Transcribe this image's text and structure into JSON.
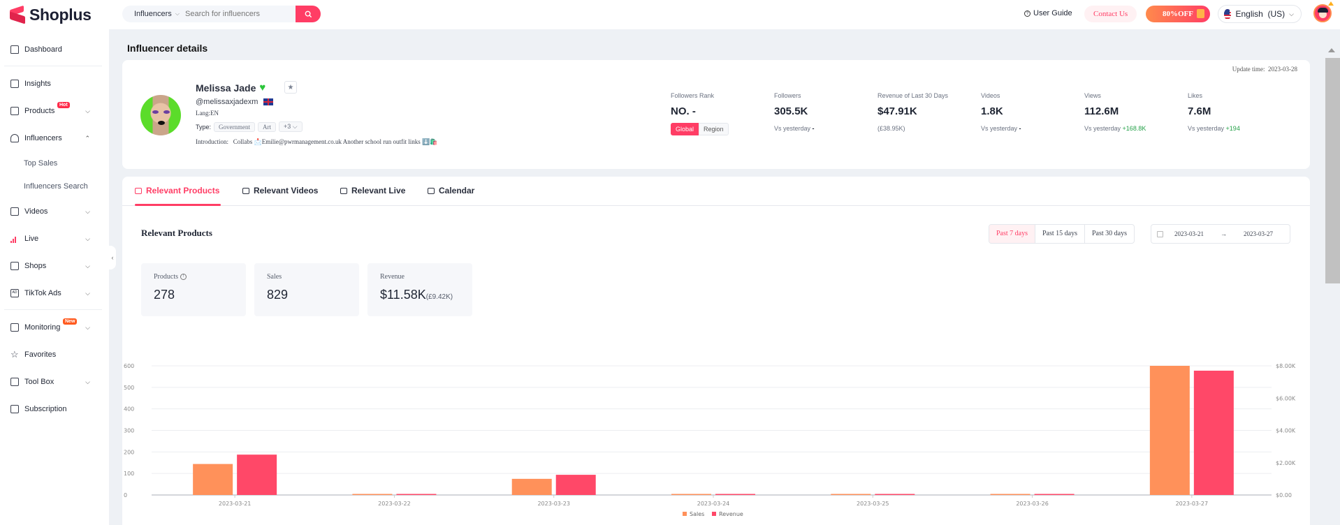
{
  "app": {
    "name": "Shoplus"
  },
  "search": {
    "category": "Influencers",
    "placeholder": "Search for influencers"
  },
  "topbar": {
    "user_guide": "User Guide",
    "contact": "Contact Us",
    "promo": "80%OFF",
    "language": "English  (US)"
  },
  "sidebar": {
    "items": [
      {
        "label": "Dashboard",
        "icon": "home-icon"
      },
      {
        "label": "Insights",
        "icon": "chart-icon"
      },
      {
        "label": "Products",
        "icon": "bag-icon",
        "badge": "Hot",
        "expandable": true
      },
      {
        "label": "Influencers",
        "icon": "user-icon",
        "expanded": true
      },
      {
        "label": "Videos",
        "icon": "video-icon",
        "expandable": true
      },
      {
        "label": "Live",
        "icon": "live-icon",
        "expandable": true
      },
      {
        "label": "Shops",
        "icon": "shop-icon",
        "expandable": true
      },
      {
        "label": "TikTok Ads",
        "icon": "ad-icon",
        "expandable": true
      },
      {
        "label": "Monitoring",
        "icon": "monitor-icon",
        "badge": "New",
        "expandable": true
      },
      {
        "label": "Favorites",
        "icon": "star-icon"
      },
      {
        "label": "Tool Box",
        "icon": "toolbox-icon",
        "expandable": true
      },
      {
        "label": "Subscription",
        "icon": "card-icon"
      }
    ],
    "sub_items": [
      "Top Sales",
      "Influencers Search"
    ]
  },
  "page": {
    "title": "Influencer details",
    "update_time": "Update time:  2023-03-28"
  },
  "profile": {
    "name": "Melissa Jade",
    "handle": "@melissaxjadexm",
    "lang": "Lang:EN",
    "type_label": "Type:",
    "tags": [
      "Government",
      "Art",
      "+3"
    ],
    "intro": "Introduction:   Collabs 📩Emilie@pwrmanagement.co.uk Another school run outfit links ⬇️🛍️"
  },
  "stats": [
    {
      "label": "Followers Rank",
      "value": "NO. -",
      "seg": [
        "Global",
        "Region"
      ]
    },
    {
      "label": "Followers",
      "value": "305.5K",
      "sub": "Vs yesterday",
      "delta": "-"
    },
    {
      "label": "Revenue of Last 30 Days",
      "value": "$47.91K",
      "sub": "(£38.95K)"
    },
    {
      "label": "Videos",
      "value": "1.8K",
      "sub": "Vs yesterday",
      "delta": "-"
    },
    {
      "label": "Views",
      "value": "112.6M",
      "sub": "Vs yesterday",
      "delta": "+168.8K"
    },
    {
      "label": "Likes",
      "value": "7.6M",
      "sub": "Vs yesterday",
      "delta": "+194"
    }
  ],
  "tabs": [
    "Relevant Products",
    "Relevant Videos",
    "Relevant Live",
    "Calendar"
  ],
  "section": {
    "title": "Relevant Products",
    "ranges": [
      "Past 7 days",
      "Past 15 days",
      "Past 30 days"
    ],
    "date_start": "2023-03-21",
    "date_end": "2023-03-27",
    "kpis": [
      {
        "label": "Products",
        "value": "278"
      },
      {
        "label": "Sales",
        "value": "829"
      },
      {
        "label": "Revenue",
        "value": "$11.58K",
        "sub": "(£9.42K)"
      }
    ]
  },
  "colors": {
    "accent": "#ff3d65",
    "sales": "#ff915a",
    "revenue": "#ff4868"
  },
  "chart_data": {
    "type": "bar",
    "categories": [
      "2023-03-21",
      "2023-03-22",
      "2023-03-23",
      "2023-03-24",
      "2023-03-25",
      "2023-03-26",
      "2023-03-27"
    ],
    "series": [
      {
        "name": "Sales",
        "axis": "left",
        "values": [
          144,
          1,
          75,
          3,
          4,
          2,
          600
        ]
      },
      {
        "name": "Revenue",
        "axis": "right",
        "values": [
          2500,
          20,
          1250,
          50,
          40,
          20,
          7700
        ]
      }
    ],
    "left_axis": {
      "ticks": [
        "0",
        "100",
        "200",
        "300",
        "400",
        "500",
        "600"
      ],
      "range": [
        0,
        600
      ]
    },
    "right_axis": {
      "ticks": [
        "$0.00",
        "$2.00K",
        "$4.00K",
        "$6.00K",
        "$8.00K"
      ],
      "range": [
        0,
        8000
      ]
    },
    "legend": [
      "Sales",
      "Revenue"
    ],
    "legend_position": "bottom",
    "grid": true
  }
}
